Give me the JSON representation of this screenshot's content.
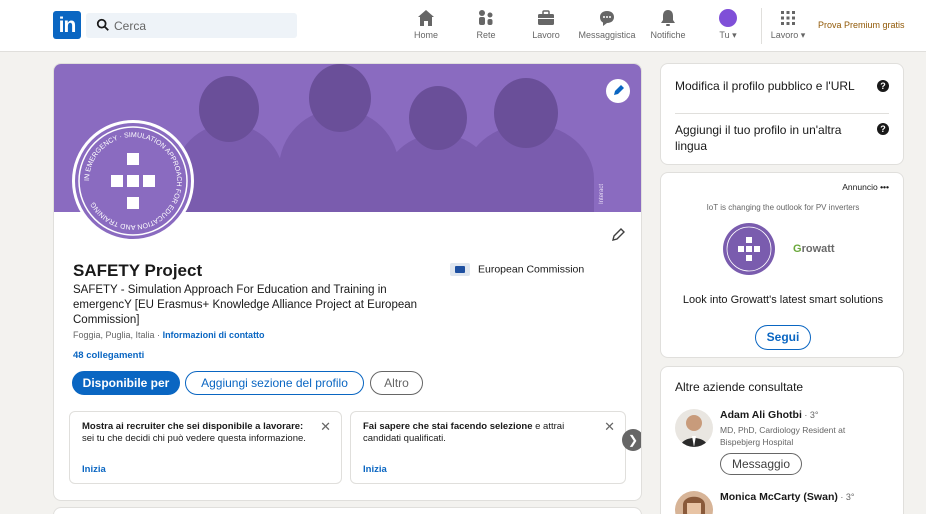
{
  "nav": {
    "search_placeholder": "Cerca",
    "items": [
      {
        "label": "Home",
        "icon": "home-icon"
      },
      {
        "label": "Rete",
        "icon": "network-icon"
      },
      {
        "label": "Lavoro",
        "icon": "briefcase-icon"
      },
      {
        "label": "Messaggistica",
        "icon": "messaging-icon"
      },
      {
        "label": "Notifiche",
        "icon": "bell-icon"
      },
      {
        "label": "Tu ▾",
        "icon": "avatar-icon"
      },
      {
        "label": "Lavoro ▾",
        "icon": "grid-icon"
      }
    ],
    "premium": "Prova Premium gratis"
  },
  "profile": {
    "name": "SAFETY Project",
    "headline": "SAFETY - Simulation Approach For Education and Training in emergencY [EU Erasmus+ Knowledge Alliance Project at European Commission]",
    "location": "Foggia, Puglia, Italia · ",
    "contact_link": "Informazioni di contatto",
    "connections": "48 collegamenti",
    "company": "European Commission",
    "banner_watermark": "Interact",
    "logo_ring_text": "IN EMERGENCY · SIMULATION APPROACH FOR EDUCATION AND TRAINING",
    "buttons": {
      "primary": "Disponibile per",
      "secondary": "Aggiungi sezione del profilo",
      "tertiary": "Altro"
    },
    "open_cards": [
      {
        "bold": "Mostra ai recruiter che sei disponibile a lavorare:",
        "text": " sei tu che decidi chi può vedere questa informazione.",
        "action": "Inizia"
      },
      {
        "bold": "Fai sapere che stai facendo selezione",
        "text": " e attrai candidati qualificati.",
        "action": "Inizia"
      }
    ]
  },
  "sidebar": {
    "edit_public_profile": "Modifica il profilo pubblico e l'URL",
    "add_language": "Aggiungi il tuo profilo in un'altra lingua",
    "ad": {
      "label": "Annuncio",
      "more": "•••",
      "tagline": "IoT is changing the outlook for PV inverters",
      "brand_first": "G",
      "brand_rest": "rowatt",
      "text": "Look into Growatt's latest smart solutions",
      "follow": "Segui"
    },
    "people_title": "Altre aziende consultate",
    "people": [
      {
        "name": "Adam Ali Ghotbi",
        "degree": " · 3°",
        "desc": "MD, PhD, Cardiology Resident at Bispebjerg Hospital",
        "action": "Messaggio"
      },
      {
        "name": "Monica McCarty (Swan)",
        "degree": " · 3°",
        "desc": "",
        "action": ""
      }
    ]
  },
  "colors": {
    "brand_blue": "#0a66c2",
    "banner_purple": "#8a6bc0",
    "premium_gold": "#915907"
  }
}
